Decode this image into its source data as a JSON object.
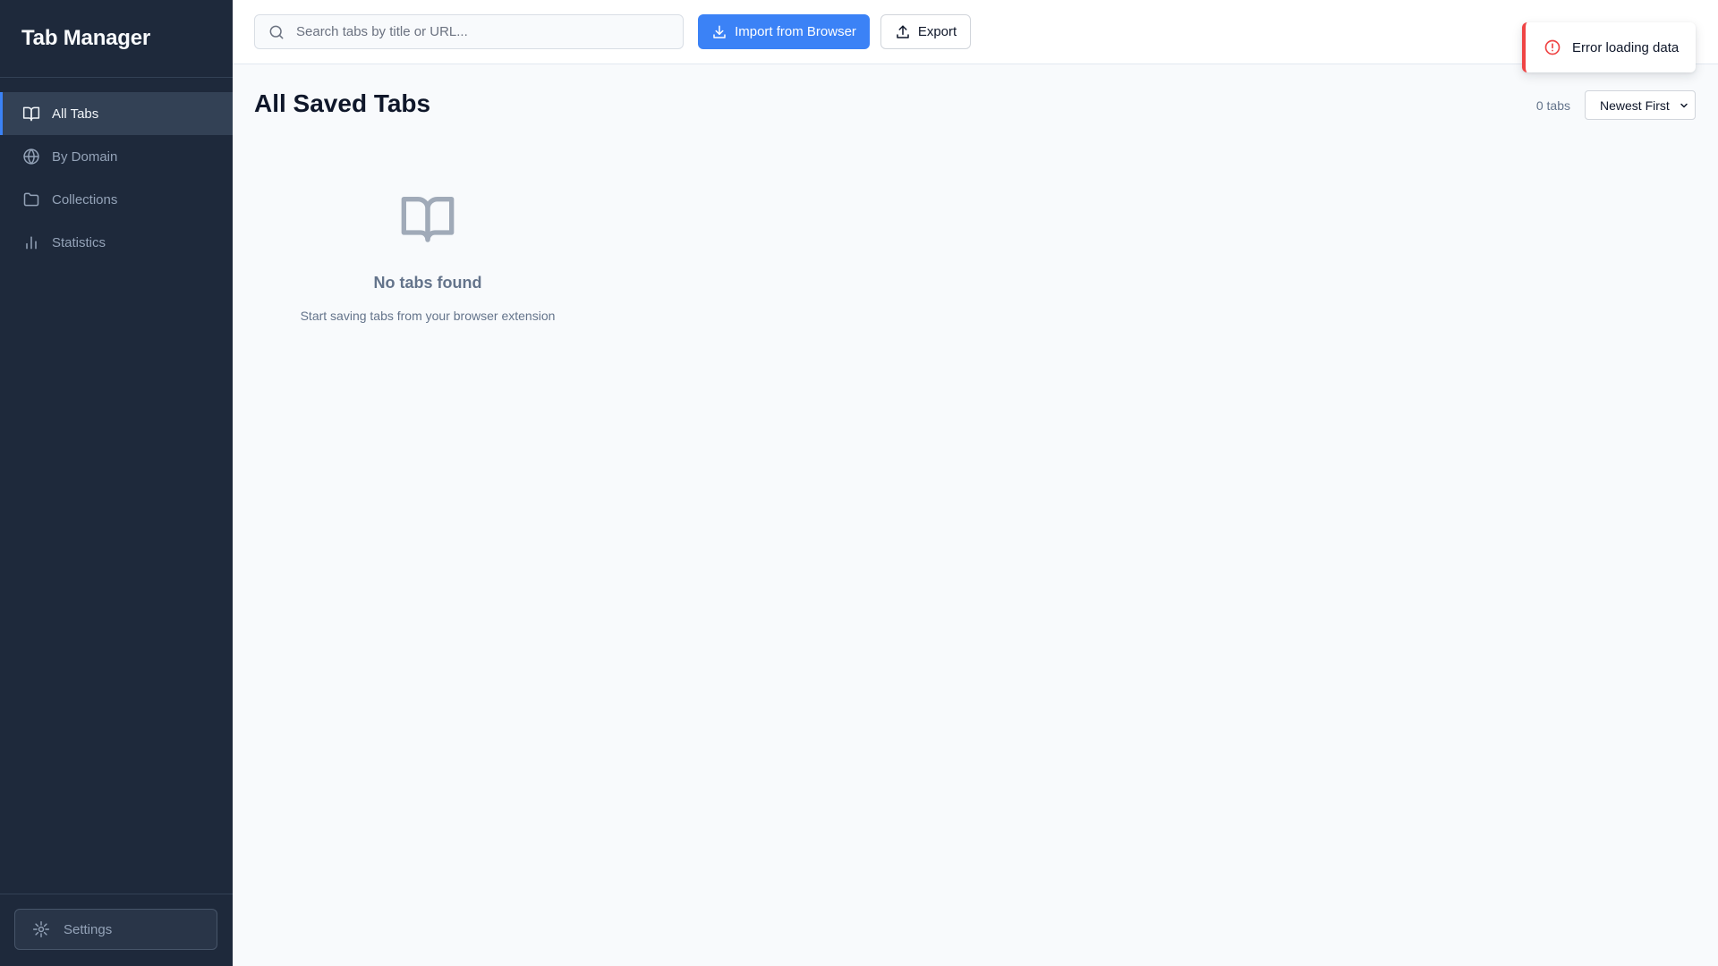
{
  "app": {
    "title": "Tab Manager"
  },
  "sidebar": {
    "items": [
      {
        "label": "All Tabs",
        "icon": "book-open-icon",
        "active": true
      },
      {
        "label": "By Domain",
        "icon": "globe-icon",
        "active": false
      },
      {
        "label": "Collections",
        "icon": "folder-icon",
        "active": false
      },
      {
        "label": "Statistics",
        "icon": "bar-chart-icon",
        "active": false
      }
    ],
    "settings_label": "Settings",
    "settings_icon": "settings-icon"
  },
  "toolbar": {
    "search_placeholder": "Search tabs by title or URL...",
    "search_value": "",
    "import_label": "Import from Browser",
    "export_label": "Export"
  },
  "main": {
    "title": "All Saved Tabs",
    "tab_count": "0 tabs",
    "sort_selected": "Newest First",
    "empty": {
      "title": "No tabs found",
      "subtitle": "Start saving tabs from your browser extension",
      "icon": "book-open-icon"
    }
  },
  "toast": {
    "message": "Error loading data",
    "icon": "alert-circle-icon"
  },
  "colors": {
    "sidebar_bg": "#1e293b",
    "accent": "#3b82f6",
    "error": "#ef4444",
    "page_bg": "#f8fafc"
  }
}
